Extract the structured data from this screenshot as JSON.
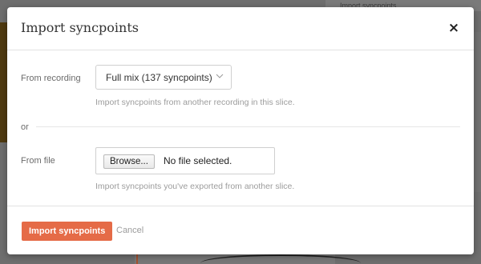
{
  "background": {
    "right_panel_heading": "Import syncpoints"
  },
  "modal": {
    "title": "Import syncpoints",
    "close_glyph": "×",
    "recording": {
      "label": "From recording",
      "selected": "Full mix (137 syncpoints)",
      "help": "Import syncpoints from another recording in this slice."
    },
    "or_label": "or",
    "file": {
      "label": "From file",
      "browse_label": "Browse...",
      "status": "No file selected.",
      "help": "Import syncpoints you've exported from another slice."
    },
    "footer": {
      "submit_label": "Import syncpoints",
      "cancel_label": "Cancel"
    }
  },
  "colors": {
    "accent": "#e56b47",
    "overlay": "#6e6e6e"
  },
  "icons": {
    "close": "close-icon",
    "dropdown": "chevron-down-icon"
  }
}
